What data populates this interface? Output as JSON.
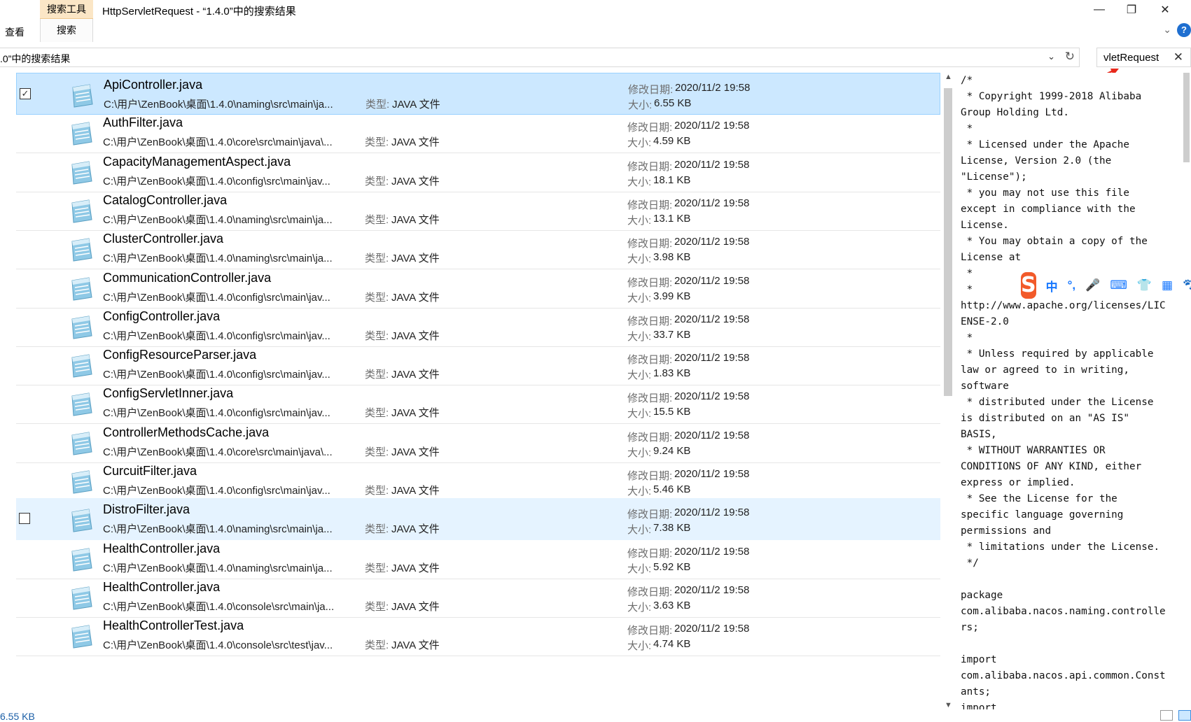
{
  "window": {
    "title": "HttpServletRequest - “1.4.0”中的搜索结果",
    "minimize_glyph": "—",
    "maximize_glyph": "❐",
    "close_glyph": "✕"
  },
  "ribbon": {
    "context_tab_group": "搜索工具",
    "context_tab": "搜索",
    "view_tab": "查看",
    "collapse_glyph": "⌄",
    "help_glyph": "?"
  },
  "address": {
    "text": ".0”中的搜索结果",
    "dropdown_glyph": "⌄",
    "refresh_glyph": "↻"
  },
  "search": {
    "value": "vletRequest",
    "clear_glyph": "✕"
  },
  "labels": {
    "type": "类型:",
    "date": "修改日期:",
    "size": "大小:"
  },
  "files": [
    {
      "name": "ApiController.java",
      "path": "C:\\用户\\ZenBook\\桌面\\1.4.0\\naming\\src\\main\\ja...",
      "type": "JAVA 文件",
      "date": "2020/11/2 19:58",
      "size": "6.55 KB",
      "state": "selected",
      "checked": true
    },
    {
      "name": "AuthFilter.java",
      "path": "C:\\用户\\ZenBook\\桌面\\1.4.0\\core\\src\\main\\java\\...",
      "type": "JAVA 文件",
      "date": "2020/11/2 19:58",
      "size": "4.59 KB",
      "state": "",
      "checked": false
    },
    {
      "name": "CapacityManagementAspect.java",
      "path": "C:\\用户\\ZenBook\\桌面\\1.4.0\\config\\src\\main\\jav...",
      "type": "JAVA 文件",
      "date": "2020/11/2 19:58",
      "size": "18.1 KB",
      "state": "",
      "checked": false
    },
    {
      "name": "CatalogController.java",
      "path": "C:\\用户\\ZenBook\\桌面\\1.4.0\\naming\\src\\main\\ja...",
      "type": "JAVA 文件",
      "date": "2020/11/2 19:58",
      "size": "13.1 KB",
      "state": "",
      "checked": false
    },
    {
      "name": "ClusterController.java",
      "path": "C:\\用户\\ZenBook\\桌面\\1.4.0\\naming\\src\\main\\ja...",
      "type": "JAVA 文件",
      "date": "2020/11/2 19:58",
      "size": "3.98 KB",
      "state": "",
      "checked": false
    },
    {
      "name": "CommunicationController.java",
      "path": "C:\\用户\\ZenBook\\桌面\\1.4.0\\config\\src\\main\\jav...",
      "type": "JAVA 文件",
      "date": "2020/11/2 19:58",
      "size": "3.99 KB",
      "state": "",
      "checked": false
    },
    {
      "name": "ConfigController.java",
      "path": "C:\\用户\\ZenBook\\桌面\\1.4.0\\config\\src\\main\\jav...",
      "type": "JAVA 文件",
      "date": "2020/11/2 19:58",
      "size": "33.7 KB",
      "state": "",
      "checked": false
    },
    {
      "name": "ConfigResourceParser.java",
      "path": "C:\\用户\\ZenBook\\桌面\\1.4.0\\config\\src\\main\\jav...",
      "type": "JAVA 文件",
      "date": "2020/11/2 19:58",
      "size": "1.83 KB",
      "state": "",
      "checked": false
    },
    {
      "name": "ConfigServletInner.java",
      "path": "C:\\用户\\ZenBook\\桌面\\1.4.0\\config\\src\\main\\jav...",
      "type": "JAVA 文件",
      "date": "2020/11/2 19:58",
      "size": "15.5 KB",
      "state": "",
      "checked": false
    },
    {
      "name": "ControllerMethodsCache.java",
      "path": "C:\\用户\\ZenBook\\桌面\\1.4.0\\core\\src\\main\\java\\...",
      "type": "JAVA 文件",
      "date": "2020/11/2 19:58",
      "size": "9.24 KB",
      "state": "",
      "checked": false
    },
    {
      "name": "CurcuitFilter.java",
      "path": "C:\\用户\\ZenBook\\桌面\\1.4.0\\config\\src\\main\\jav...",
      "type": "JAVA 文件",
      "date": "2020/11/2 19:58",
      "size": "5.46 KB",
      "state": "",
      "checked": false
    },
    {
      "name": "DistroFilter.java",
      "path": "C:\\用户\\ZenBook\\桌面\\1.4.0\\naming\\src\\main\\ja...",
      "type": "JAVA 文件",
      "date": "2020/11/2 19:58",
      "size": "7.38 KB",
      "state": "hover",
      "checked": false
    },
    {
      "name": "HealthController.java",
      "path": "C:\\用户\\ZenBook\\桌面\\1.4.0\\naming\\src\\main\\ja...",
      "type": "JAVA 文件",
      "date": "2020/11/2 19:58",
      "size": "5.92 KB",
      "state": "",
      "checked": false
    },
    {
      "name": "HealthController.java",
      "path": "C:\\用户\\ZenBook\\桌面\\1.4.0\\console\\src\\main\\ja...",
      "type": "JAVA 文件",
      "date": "2020/11/2 19:58",
      "size": "3.63 KB",
      "state": "",
      "checked": false
    },
    {
      "name": "HealthControllerTest.java",
      "path": "C:\\用户\\ZenBook\\桌面\\1.4.0\\console\\src\\test\\jav...",
      "type": "JAVA 文件",
      "date": "2020/11/2 19:58",
      "size": "4.74 KB",
      "state": "",
      "checked": false
    }
  ],
  "preview": {
    "text": "/*\n * Copyright 1999-2018 Alibaba\nGroup Holding Ltd.\n *\n * Licensed under the Apache\nLicense, Version 2.0 (the\n\"License\");\n * you may not use this file\nexcept in compliance with the\nLicense.\n * You may obtain a copy of the\nLicense at\n *\n *\nhttp://www.apache.org/licenses/LIC\nENSE-2.0\n *\n * Unless required by applicable\nlaw or agreed to in writing,\nsoftware\n * distributed under the License\nis distributed on an \"AS IS\"\nBASIS,\n * WITHOUT WARRANTIES OR\nCONDITIONS OF ANY KIND, either\nexpress or implied.\n * See the License for the\nspecific language governing\npermissions and\n * limitations under the License.\n */\n\npackage\ncom.alibaba.nacos.naming.controlle\nrs;\n\nimport\ncom.alibaba.nacos.api.common.Const\nants;\nimport"
  },
  "ime": {
    "logo": "S",
    "items": [
      "中",
      "°,",
      "🎤",
      "⌨",
      "👕",
      "▦",
      "🐾"
    ]
  },
  "status": {
    "text": "6.55 KB"
  },
  "colors": {
    "selected_bg": "#cce8ff",
    "hover_bg": "#e5f3ff",
    "context_tab": "#fbe6c6",
    "status_text": "#1b5fa7"
  }
}
